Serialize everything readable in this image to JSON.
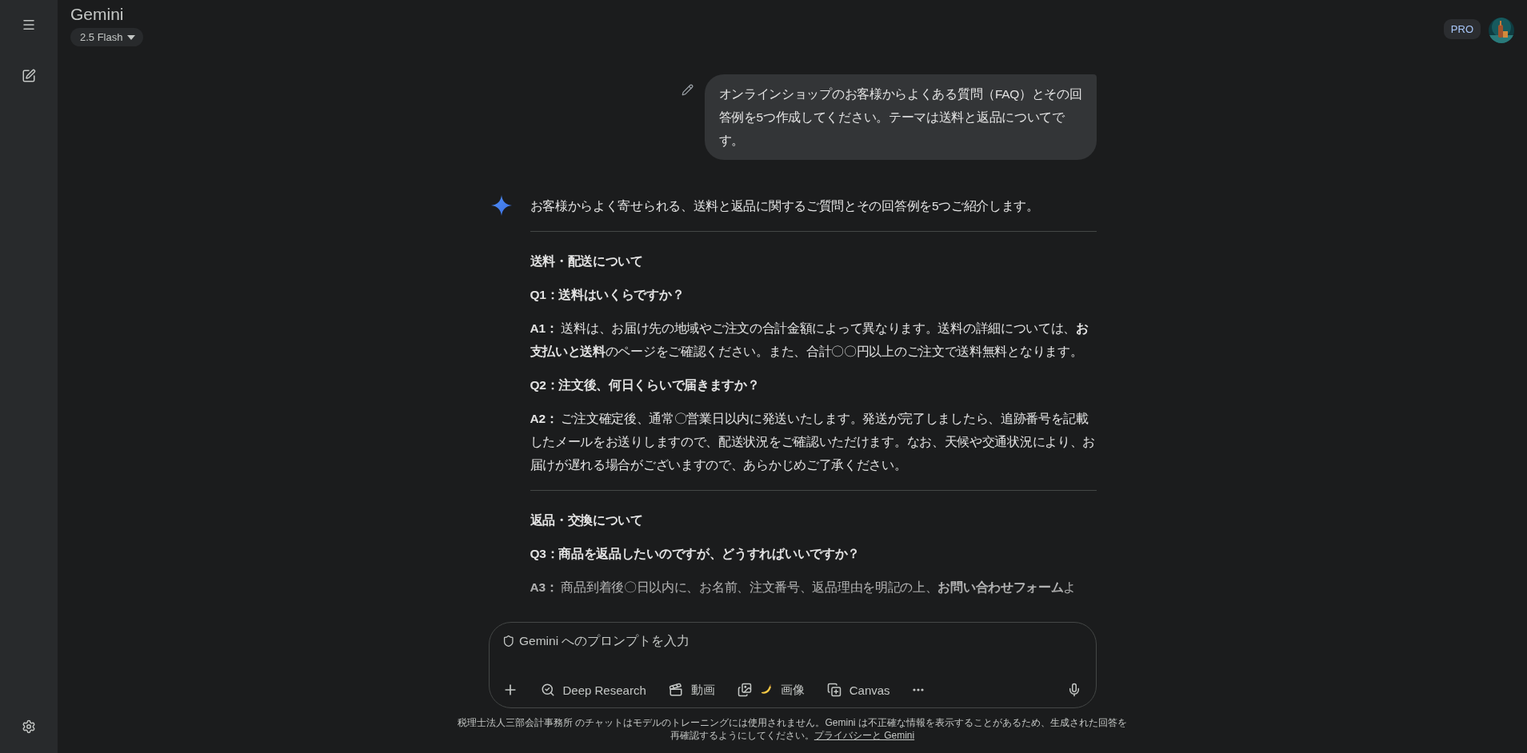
{
  "header": {
    "title": "Gemini",
    "model_picker": {
      "label": "2.5 Flash"
    },
    "plan_badge": "PRO"
  },
  "conversation": {
    "user_message": "オンラインショップのお客様からよくある質問（FAQ）とその回答例を5つ作成してください。テーマは送料と返品についてです。",
    "response": {
      "intro": "お客様からよく寄せられる、送料と返品に関するご質問とその回答例を5つご紹介します。",
      "sections": [
        {
          "heading": "送料・配送について",
          "faqs": [
            {
              "question": "Q1：送料はいくらですか？",
              "answer": "**A1：** 送料は、お届け先の地域やご注文の合計金額によって異なります。送料の詳細については、**お支払いと送料**のページをご確認ください。また、合計〇〇円以上のご注文で送料無料となります。"
            },
            {
              "question": "Q2：注文後、何日くらいで届きますか？",
              "answer": "**A2：** ご注文確定後、通常〇営業日以内に発送いたします。発送が完了しましたら、追跡番号を記載したメールをお送りしますので、配送状況をご確認いただけます。なお、天候や交通状況により、お届けが遅れる場合がございますので、あらかじめご了承ください。"
            }
          ]
        },
        {
          "heading": "返品・交換について",
          "faqs": [
            {
              "question": "Q3：商品を返品したいのですが、どうすればいいですか？",
              "answer": "**A3：** 商品到着後〇日以内に、お名前、注文番号、返品理由を明記の上、**お問い合わせフォーム**よ"
            }
          ]
        }
      ]
    }
  },
  "composer": {
    "placeholder": "Gemini へのプロンプトを入力",
    "tools": [
      {
        "kind": "add"
      },
      {
        "kind": "deep_research",
        "label": "Deep Research"
      },
      {
        "kind": "video",
        "label": "動画"
      },
      {
        "label": "画像"
      },
      {
        "kind": "canvas",
        "label": "Canvas"
      },
      {
        "kind": "more"
      }
    ]
  },
  "footer": {
    "text": "税理士法人三部会計事務所 のチャットはモデルのトレーニングには使用されません。Gemini は不正確な情報を表示することがあるため、生成された回答を再確認するようにしてください。",
    "link": "プライバシーと Gemini"
  }
}
